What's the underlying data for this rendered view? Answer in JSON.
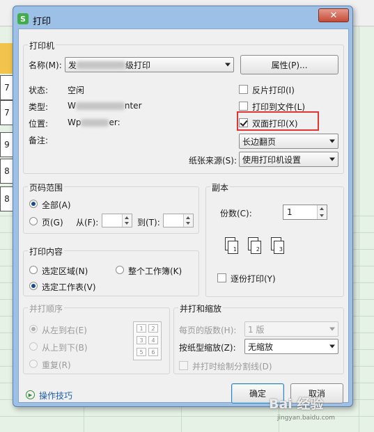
{
  "dialog": {
    "title": "打印",
    "app_icon": "S",
    "close_glyph": "✕"
  },
  "printer_group": {
    "title": "打印机",
    "name_label": "名称(M):",
    "name_value_prefix": "发",
    "name_value_suffix": "级打印",
    "properties_button": "属性(P)...",
    "status_label": "状态:",
    "status_value": "空闲",
    "type_label": "类型:",
    "type_value_prefix": "W",
    "type_value_suffix": "nter",
    "location_label": "位置:",
    "location_value_prefix": "Wp",
    "location_value_suffix": "er:",
    "comment_label": "备注:",
    "reverse_print": "反片打印(I)",
    "print_to_file": "打印到文件(L)",
    "duplex_print": "双面打印(X)",
    "duplex_mode": "长边翻页",
    "paper_source_label": "纸张来源(S):",
    "paper_source_value": "使用打印机设置"
  },
  "page_range": {
    "title": "页码范围",
    "all": "全部(A)",
    "pages": "页(G)",
    "from_label": "从(F):",
    "to_label": "到(T):",
    "from_value": "",
    "to_value": ""
  },
  "copies": {
    "title": "副本",
    "count_label": "份数(C):",
    "count_value": "1",
    "collate": "逐份打印(Y)",
    "page_icons": [
      "1",
      "1",
      "2",
      "2",
      "3",
      "3"
    ]
  },
  "print_content": {
    "title": "打印内容",
    "selection": "选定区域(N)",
    "workbook": "整个工作簿(K)",
    "worksheet": "选定工作表(V)"
  },
  "print_order": {
    "title": "并打顺序",
    "left_to_right": "从左到右(E)",
    "top_to_bottom": "从上到下(B)",
    "repeat": "重复(R)",
    "grid": [
      "1",
      "2",
      "3",
      "4",
      "5",
      "6"
    ]
  },
  "merge_scale": {
    "title": "并打和缩放",
    "pages_per_sheet_label": "每页的版数(H):",
    "pages_per_sheet_value": "1 版",
    "scale_label": "按纸型缩放(Z):",
    "scale_value": "无缩放",
    "draw_borders": "并打时绘制分割线(D)"
  },
  "footer": {
    "tips": "操作技巧",
    "ok": "确定",
    "cancel": "取消"
  },
  "background_rows": [
    "7",
    "7",
    "9",
    "8",
    "8"
  ],
  "watermark": {
    "brand": "Bai 经验",
    "url": "jingyan.baidu.com"
  },
  "colors": {
    "dialog_frame": "#9dc1e6",
    "highlight_box": "#e23434",
    "column_header": "#f2c34d",
    "sheet_background": "#e6f2e6"
  }
}
